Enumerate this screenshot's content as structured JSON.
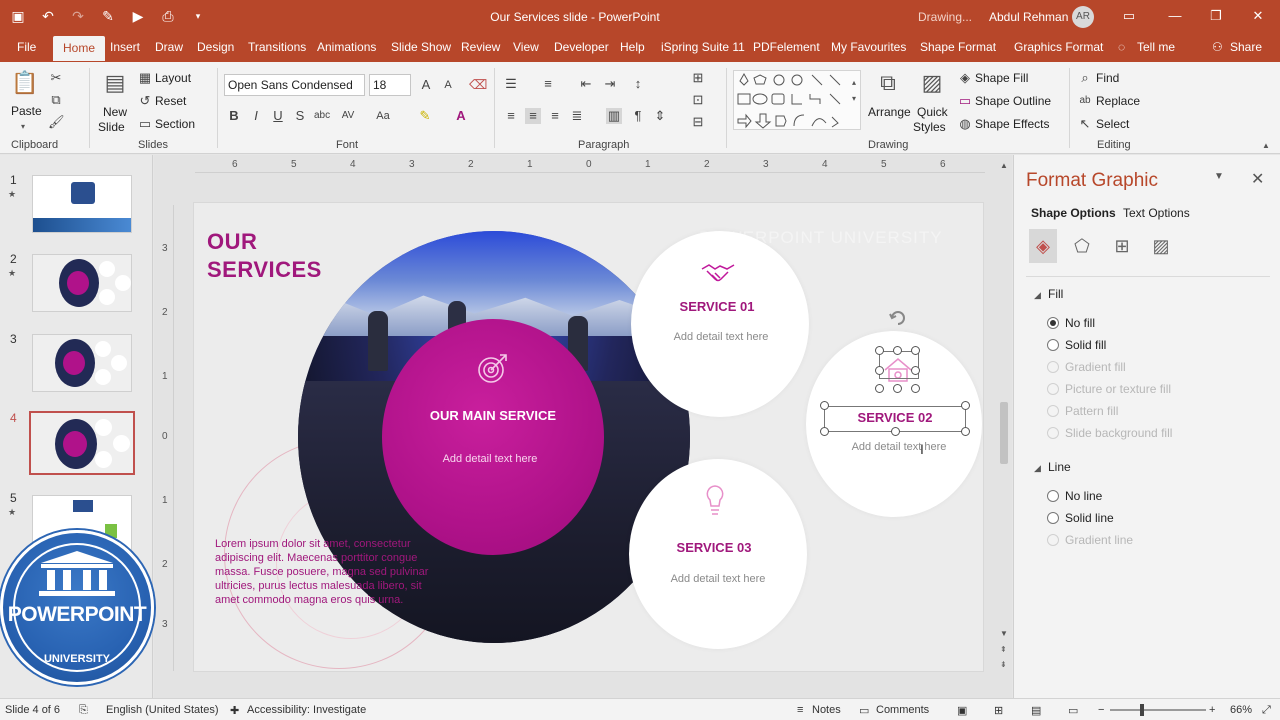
{
  "app": {
    "document_title": "Our Services slide",
    "app_name": "PowerPoint",
    "title_separator": " - ",
    "status_text": "Drawing...",
    "user_name": "Abdul Rehman",
    "user_initials": "AR"
  },
  "tabs": [
    {
      "label": "File",
      "active": false
    },
    {
      "label": "Home",
      "active": true
    },
    {
      "label": "Insert",
      "active": false
    },
    {
      "label": "Draw",
      "active": false
    },
    {
      "label": "Design",
      "active": false
    },
    {
      "label": "Transitions",
      "active": false
    },
    {
      "label": "Animations",
      "active": false
    },
    {
      "label": "Slide Show",
      "active": false
    },
    {
      "label": "Review",
      "active": false
    },
    {
      "label": "View",
      "active": false
    },
    {
      "label": "Developer",
      "active": false
    },
    {
      "label": "Help",
      "active": false
    },
    {
      "label": "iSpring Suite 11",
      "active": false
    },
    {
      "label": "PDFelement",
      "active": false
    },
    {
      "label": "My Favourites",
      "active": false
    },
    {
      "label": "Shape Format",
      "active": false
    },
    {
      "label": "Graphics Format",
      "active": false
    },
    {
      "label": "Tell me",
      "active": false
    }
  ],
  "share_label": "Share",
  "ribbon": {
    "clipboard": {
      "label": "Clipboard",
      "paste": "Paste"
    },
    "slides": {
      "label": "Slides",
      "new_slide_1": "New",
      "new_slide_2": "Slide",
      "layout": "Layout",
      "reset": "Reset",
      "section": "Section"
    },
    "font": {
      "label": "Font",
      "font_name": "Open Sans Condensed",
      "font_size": "18"
    },
    "paragraph": {
      "label": "Paragraph"
    },
    "drawing": {
      "label": "Drawing",
      "arrange": "Arrange",
      "quick_styles_1": "Quick",
      "quick_styles_2": "Styles",
      "shape_fill": "Shape Fill",
      "shape_outline": "Shape Outline",
      "shape_effects": "Shape Effects"
    },
    "editing": {
      "label": "Editing",
      "find": "Find",
      "replace": "Replace",
      "select": "Select"
    }
  },
  "thumbnails": [
    {
      "number": "1",
      "star": "★"
    },
    {
      "number": "2",
      "star": "★"
    },
    {
      "number": "3",
      "star": ""
    },
    {
      "number": "4",
      "star": ""
    },
    {
      "number": "5",
      "star": "★"
    }
  ],
  "selected_slide": 4,
  "slide": {
    "title_line1": "OUR",
    "title_line2": "SERVICES",
    "watermark": "POWERPOINT UNIVERSITY",
    "main_service_title": "OUR MAIN SERVICE",
    "main_service_detail": "Add detail text here",
    "services": [
      {
        "title": "SERVICE 01",
        "detail": "Add detail text here",
        "icon": "handshake-icon"
      },
      {
        "title": "SERVICE 02",
        "detail": "Add detail text here",
        "icon": "home-icon"
      },
      {
        "title": "SERVICE 03",
        "detail": "Add detail text here",
        "icon": "lightbulb-icon"
      }
    ],
    "lorem": "Lorem ipsum dolor sit amet, consectetur adipiscing elit. Maecenas porttitor congue massa. Fusce posuere, magna sed pulvinar ultricies, purus lectus malesuada libero, sit amet commodo magna eros quis urna."
  },
  "ruler": {
    "h_ticks": [
      "6",
      "5",
      "4",
      "3",
      "2",
      "1",
      "0",
      "1",
      "2",
      "3",
      "4",
      "5",
      "6"
    ],
    "v_ticks": [
      "3",
      "2",
      "1",
      "0",
      "1",
      "2",
      "3"
    ]
  },
  "format_pane": {
    "title": "Format Graphic",
    "tab_shape_options": "Shape Options",
    "tab_text_options": "Text Options",
    "fill_section": "Fill",
    "fill_options": [
      {
        "label": "No fill",
        "selected": true,
        "disabled": false
      },
      {
        "label": "Solid fill",
        "selected": false,
        "disabled": false
      },
      {
        "label": "Gradient fill",
        "selected": false,
        "disabled": true
      },
      {
        "label": "Picture or texture fill",
        "selected": false,
        "disabled": true
      },
      {
        "label": "Pattern fill",
        "selected": false,
        "disabled": true
      },
      {
        "label": "Slide background fill",
        "selected": false,
        "disabled": true
      }
    ],
    "line_section": "Line",
    "line_options": [
      {
        "label": "No line",
        "selected": false,
        "disabled": false
      },
      {
        "label": "Solid line",
        "selected": false,
        "disabled": false
      },
      {
        "label": "Gradient line",
        "selected": false,
        "disabled": true
      }
    ]
  },
  "statusbar": {
    "slide_info": "Slide 4 of 6",
    "language": "English (United States)",
    "accessibility": "Accessibility: Investigate",
    "notes": "Notes",
    "comments": "Comments",
    "zoom": "66%"
  },
  "logo": {
    "word1": "POWERPOINT",
    "word2": "UNIVERSITY"
  },
  "colors": {
    "accent": "#b7472a",
    "brand_magenta": "#a0187c",
    "logo_blue": "#2862b2"
  }
}
